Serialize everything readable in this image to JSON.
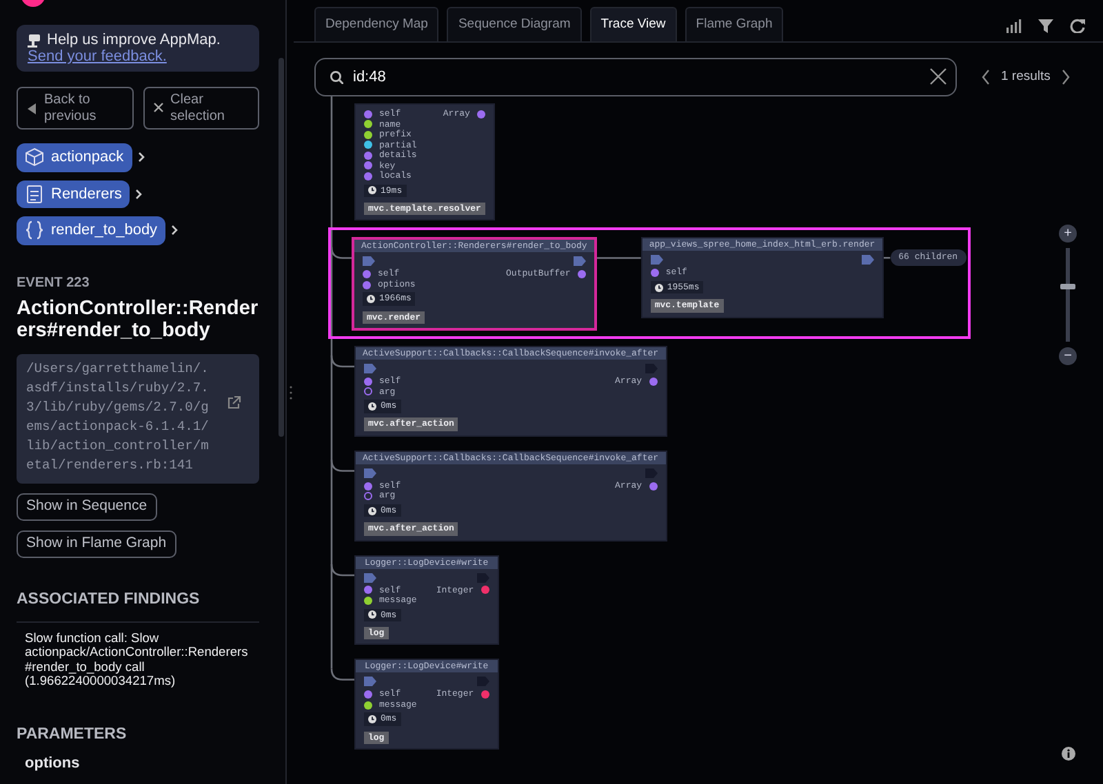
{
  "sidebar": {
    "feedback": {
      "text": "Help us improve AppMap.",
      "link": "Send your feedback."
    },
    "nav_buttons": [
      {
        "label": "Back to previous",
        "kind": "back"
      },
      {
        "label": "Clear selection",
        "kind": "clear"
      }
    ],
    "breadcrumbs": [
      {
        "label": "actionpack",
        "kind": "package"
      },
      {
        "label": "Renderers",
        "kind": "class"
      },
      {
        "label": "render_to_body",
        "kind": "function"
      }
    ],
    "event": {
      "label": "EVENT 223",
      "title": "ActionController::Renderers#render_to_body",
      "path": "/Users/garretthamelin/.asdf/installs/ruby/2.7.3/lib/ruby/gems/2.7.0/gems/actionpack-6.1.4.1/lib/action_controller/metal/renderers.rb:141"
    },
    "actions": [
      "Show in Sequence",
      "Show in Flame Graph"
    ],
    "findings": {
      "heading": "ASSOCIATED FINDINGS",
      "items": [
        "Slow function call: Slow actionpack/ActionController::Renderers#render_to_body call (1.9662240000034217ms)"
      ]
    },
    "parameters": {
      "heading": "PARAMETERS",
      "items": [
        "options"
      ]
    }
  },
  "tabs": [
    {
      "label": "Dependency Map",
      "selected": false
    },
    {
      "label": "Sequence Diagram",
      "selected": false
    },
    {
      "label": "Trace View",
      "selected": true
    },
    {
      "label": "Flame Graph",
      "selected": false
    }
  ],
  "search": {
    "value": "id:48",
    "results": "1 results"
  },
  "zoom": {
    "in": "+",
    "out": "−",
    "level": 0.6
  },
  "trace": [
    {
      "params": [
        {
          "name": "self",
          "color": "#9b6cf0",
          "filled": true
        },
        {
          "name": "name",
          "color": "#8fd032",
          "filled": true
        },
        {
          "name": "prefix",
          "color": "#8fd032",
          "filled": true
        },
        {
          "name": "partial",
          "color": "#3fc0e6",
          "filled": true
        },
        {
          "name": "details",
          "color": "#9b6cf0",
          "filled": true
        },
        {
          "name": "key",
          "color": "#9b6cf0",
          "filled": true
        },
        {
          "name": "locals",
          "color": "#9b6cf0",
          "filled": true
        }
      ],
      "returns": {
        "type": "Array",
        "color": "#9b6cf0",
        "filled": true
      },
      "duration": "19ms",
      "label": "mvc.template.resolver",
      "selected": false,
      "highlighted": false
    },
    {
      "title": "ActionController::Renderers#render_to_body",
      "has_children": true,
      "params": [
        {
          "name": "self",
          "color": "#9b6cf0",
          "filled": true
        },
        {
          "name": "options",
          "color": "#9b6cf0",
          "filled": true
        }
      ],
      "returns": {
        "type": "OutputBuffer",
        "color": "#9b6cf0",
        "filled": true
      },
      "duration": "1966ms",
      "label": "mvc.render",
      "selected": true,
      "highlighted": true,
      "children": [
        {
          "title": "app_views_spree_home_index_html_erb.render",
          "has_children": true,
          "params": [
            {
              "name": "self",
              "color": "#9b6cf0",
              "filled": true
            }
          ],
          "duration": "1955ms",
          "label": "mvc.template",
          "selected": false,
          "more": "66 children"
        }
      ]
    },
    {
      "title": "ActiveSupport::Callbacks::CallbackSequence#invoke_after",
      "has_children": false,
      "params": [
        {
          "name": "self",
          "color": "#9b6cf0",
          "filled": true
        },
        {
          "name": "arg",
          "color": "#9b6cf0",
          "filled": false
        }
      ],
      "returns": {
        "type": "Array",
        "color": "#9b6cf0",
        "filled": true
      },
      "duration": "0ms",
      "label": "mvc.after_action",
      "selected": false,
      "highlighted": false
    },
    {
      "title": "ActiveSupport::Callbacks::CallbackSequence#invoke_after",
      "has_children": false,
      "params": [
        {
          "name": "self",
          "color": "#9b6cf0",
          "filled": true
        },
        {
          "name": "arg",
          "color": "#9b6cf0",
          "filled": false
        }
      ],
      "returns": {
        "type": "Array",
        "color": "#9b6cf0",
        "filled": true
      },
      "duration": "0ms",
      "label": "mvc.after_action",
      "selected": false,
      "highlighted": false
    },
    {
      "title": "Logger::LogDevice#write",
      "has_children": false,
      "params": [
        {
          "name": "self",
          "color": "#9b6cf0",
          "filled": true
        },
        {
          "name": "message",
          "color": "#8fd032",
          "filled": true
        }
      ],
      "returns": {
        "type": "Integer",
        "color": "#f0306a",
        "filled": true
      },
      "duration": "0ms",
      "label": "log",
      "selected": false,
      "highlighted": false
    },
    {
      "title": "Logger::LogDevice#write",
      "has_children": false,
      "params": [
        {
          "name": "self",
          "color": "#9b6cf0",
          "filled": true
        },
        {
          "name": "message",
          "color": "#8fd032",
          "filled": true
        }
      ],
      "returns": {
        "type": "Integer",
        "color": "#f0306a",
        "filled": true
      },
      "duration": "0ms",
      "label": "log",
      "selected": false,
      "highlighted": false
    }
  ]
}
